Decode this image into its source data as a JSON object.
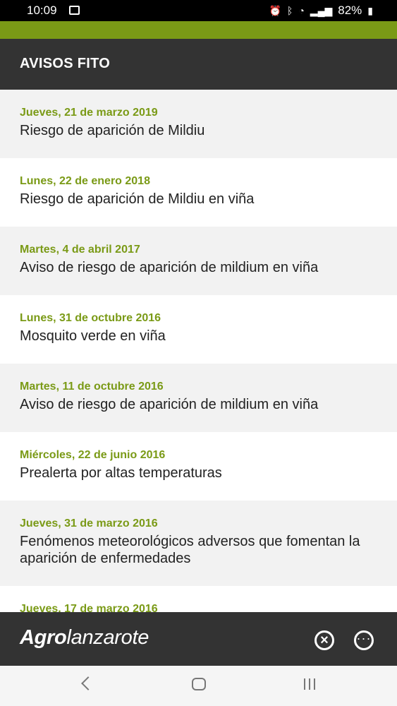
{
  "status_bar": {
    "time": "10:09",
    "battery": "82%"
  },
  "header": {
    "title": "AVISOS FITO"
  },
  "items": [
    {
      "date": "Jueves, 21 de marzo 2019",
      "text": "Riesgo de aparición de Mildiu"
    },
    {
      "date": "Lunes, 22 de enero 2018",
      "text": "Riesgo de aparición de Mildiu en viña"
    },
    {
      "date": "Martes, 4 de abril 2017",
      "text": "Aviso de riesgo de aparición de mildium en viña"
    },
    {
      "date": "Lunes, 31 de octubre 2016",
      "text": "Mosquito verde en viña"
    },
    {
      "date": "Martes, 11 de octubre 2016",
      "text": "Aviso de riesgo de aparición de mildium en viña"
    },
    {
      "date": "Miércoles, 22 de junio 2016",
      "text": "Prealerta por altas temperaturas"
    },
    {
      "date": "Jueves, 31 de marzo 2016",
      "text": "Fenómenos meteorológicos adversos que fomentan la aparición de enfermedades"
    },
    {
      "date": "Jueves, 17 de marzo 2016",
      "text": ""
    }
  ],
  "bottom_bar": {
    "logo_part1": "Agro",
    "logo_part2": "lanzarote",
    "close_icon": "close-circle-icon",
    "more_icon": "more-horizontal-icon"
  },
  "colors": {
    "accent": "#7a9a16",
    "header": "#333333",
    "row_light": "#f2f2f2",
    "row_white": "#ffffff"
  }
}
